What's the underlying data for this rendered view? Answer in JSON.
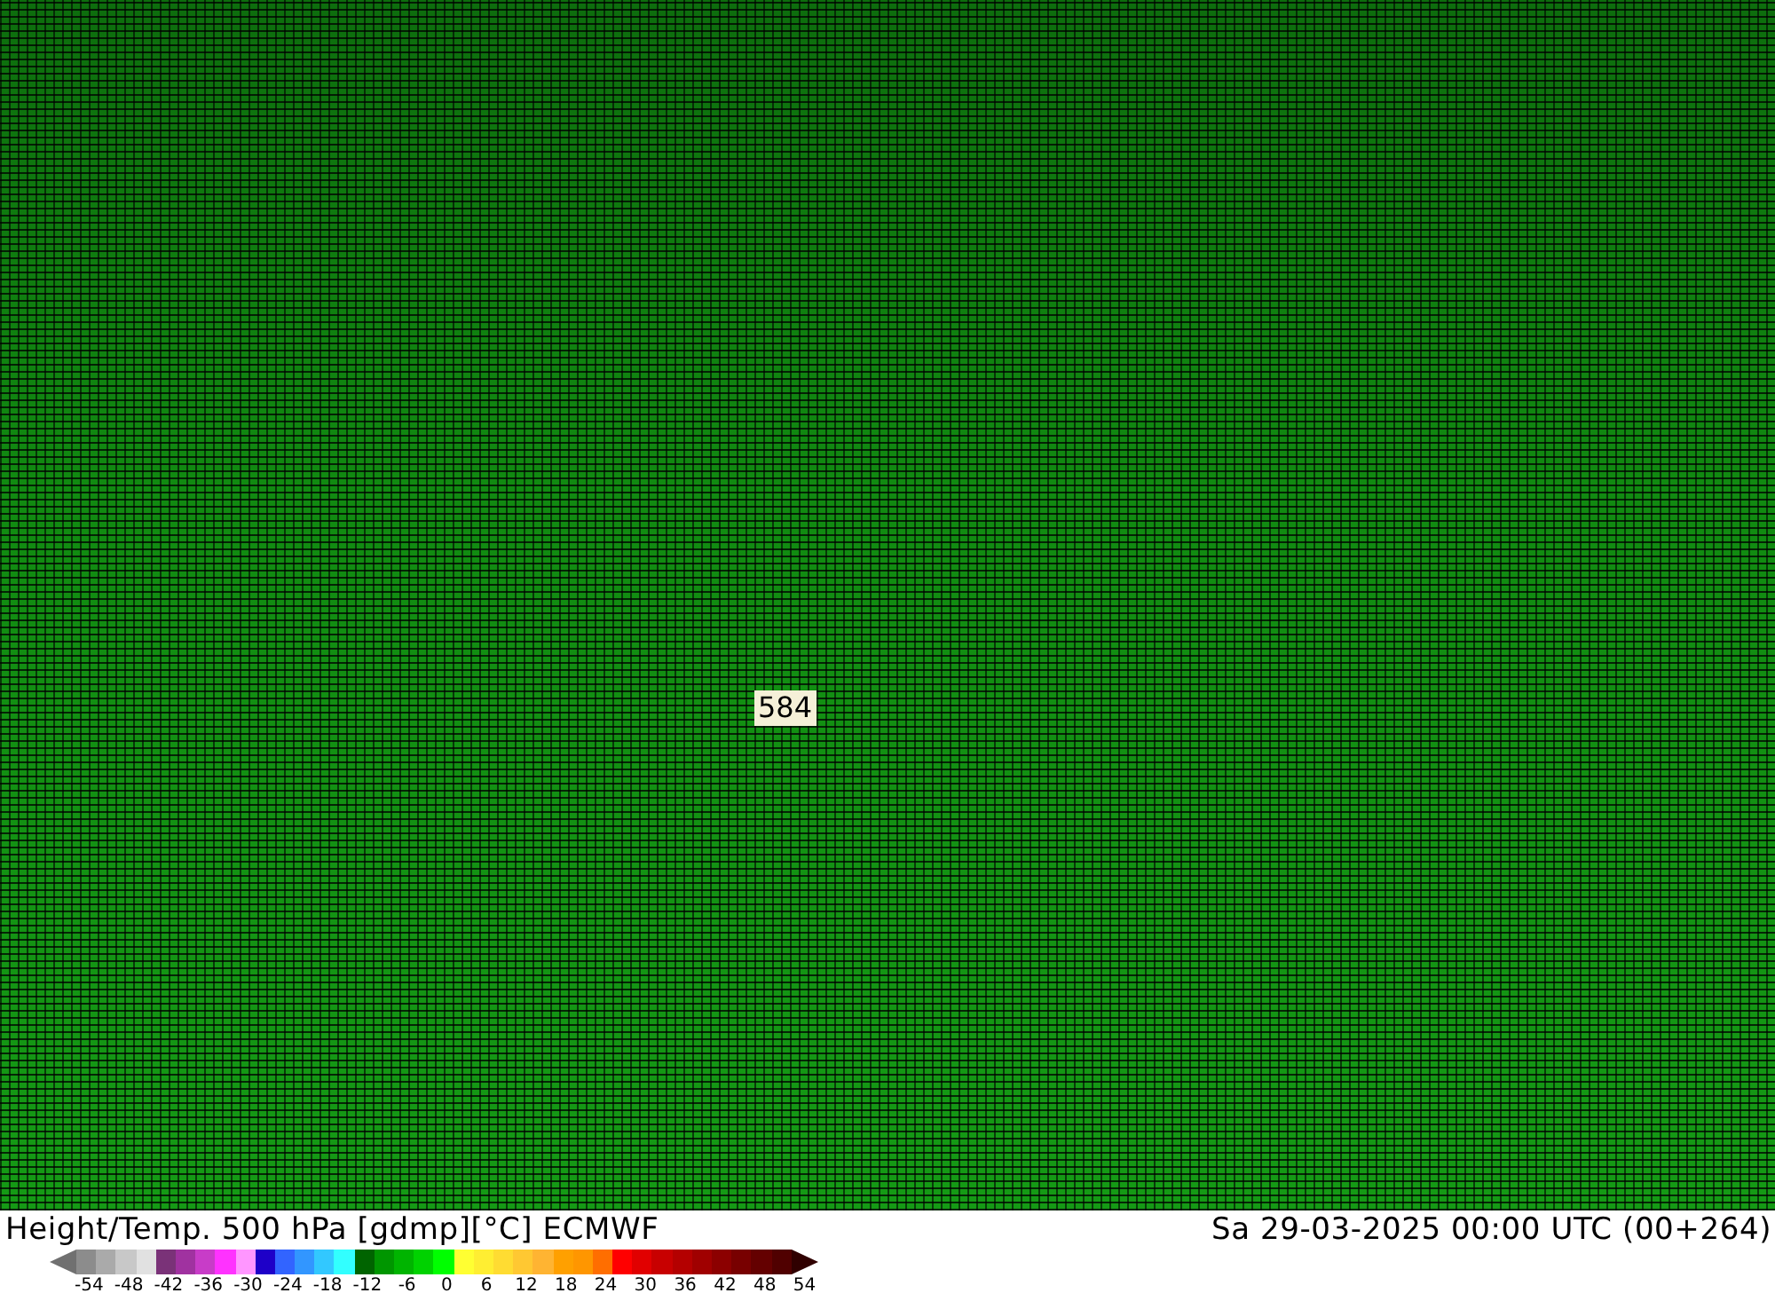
{
  "map": {
    "contour_label": "584"
  },
  "footer": {
    "title": "Height/Temp. 500 hPa [gdmp][°C] ECMWF",
    "valid_time": "Sa 29-03-2025 00:00 UTC (00+264)"
  },
  "colorbar": {
    "swatches": [
      {
        "kind": "arrow_low",
        "color": "#707070"
      },
      {
        "color": "#8c8c8c"
      },
      {
        "color": "#aaaaaa"
      },
      {
        "color": "#c8c8c8"
      },
      {
        "color": "#e1e1e1"
      },
      {
        "color": "#7a3278"
      },
      {
        "color": "#a032a0"
      },
      {
        "color": "#c83cc8"
      },
      {
        "color": "#ff32ff"
      },
      {
        "color": "#ff96ff"
      },
      {
        "color": "#1e00c8"
      },
      {
        "color": "#3264ff"
      },
      {
        "color": "#3296ff"
      },
      {
        "color": "#32c8ff"
      },
      {
        "color": "#32ffff"
      },
      {
        "color": "#006400"
      },
      {
        "color": "#009600"
      },
      {
        "color": "#00b400"
      },
      {
        "color": "#00d200"
      },
      {
        "color": "#00ff00"
      },
      {
        "color": "#ffff32"
      },
      {
        "color": "#ffee32"
      },
      {
        "color": "#ffdc32"
      },
      {
        "color": "#ffc832"
      },
      {
        "color": "#ffb432"
      },
      {
        "color": "#ffa000"
      },
      {
        "color": "#ff9600"
      },
      {
        "color": "#ff6e00"
      },
      {
        "color": "#ff0000"
      },
      {
        "color": "#e10000"
      },
      {
        "color": "#c80000"
      },
      {
        "color": "#b40000"
      },
      {
        "color": "#a00000"
      },
      {
        "color": "#8c0000"
      },
      {
        "color": "#780000"
      },
      {
        "color": "#640000"
      },
      {
        "color": "#500000"
      },
      {
        "kind": "arrow_high",
        "color": "#300000"
      }
    ],
    "tick_labels": [
      "-54",
      "-48",
      "-42",
      "-36",
      "-30",
      "-24",
      "-18",
      "-12",
      "-6",
      "0",
      "6",
      "12",
      "18",
      "24",
      "30",
      "36",
      "42",
      "48",
      "54"
    ]
  }
}
